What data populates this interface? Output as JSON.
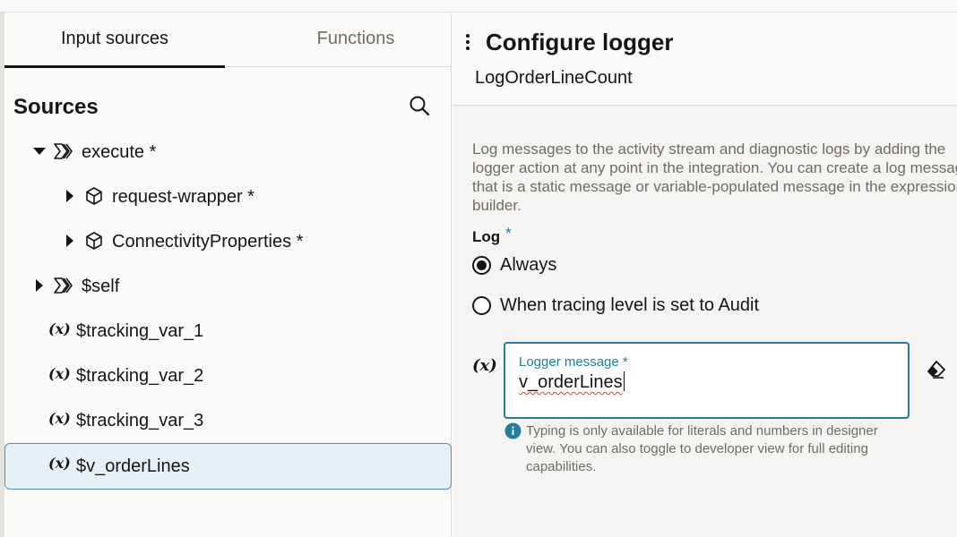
{
  "tabs": {
    "input_sources": "Input sources",
    "functions": "Functions"
  },
  "sources": {
    "title": "Sources",
    "items": [
      {
        "label": "execute *",
        "type": "group",
        "expanded": true
      },
      {
        "label": "request-wrapper *",
        "type": "object",
        "expanded": false
      },
      {
        "label": "ConnectivityProperties *",
        "type": "object",
        "expanded": false
      },
      {
        "label": "$self",
        "type": "group",
        "expanded": false
      },
      {
        "label": "$tracking_var_1",
        "type": "variable"
      },
      {
        "label": "$tracking_var_2",
        "type": "variable"
      },
      {
        "label": "$tracking_var_3",
        "type": "variable"
      },
      {
        "label": "$v_orderLines",
        "type": "variable",
        "selected": true
      }
    ],
    "var_icon": "(x)"
  },
  "panel": {
    "title": "Configure logger",
    "subtitle": "LogOrderLineCount",
    "description": "Log messages to the activity stream and diagnostic logs by adding the logger action at any point in the integration. You can create a log message that is a static message or variable-populated message in the expression builder.",
    "log_label": "Log",
    "required_mark": "*",
    "radio_always": "Always",
    "radio_audit": "When tracing level is set to Audit",
    "selected_option": "Always",
    "fx_icon": "(x)",
    "field_label": "Logger message *",
    "field_value": "v_orderLines",
    "help_text": "Typing is only available for literals and numbers in designer view. You can also toggle to developer view for full editing capabilities."
  },
  "colors": {
    "accent": "#227e9e",
    "selected_bg": "#e5f1f8",
    "selected_border": "#5a8fae",
    "text": "#161513",
    "muted": "#6f6c67",
    "spell_error": "#c74634"
  },
  "icons": {
    "search": "search-icon",
    "group": "double-chevron-icon",
    "object": "cube-icon",
    "clear": "eraser-icon",
    "info": "info-icon",
    "kebab": "kebab-menu-icon"
  }
}
